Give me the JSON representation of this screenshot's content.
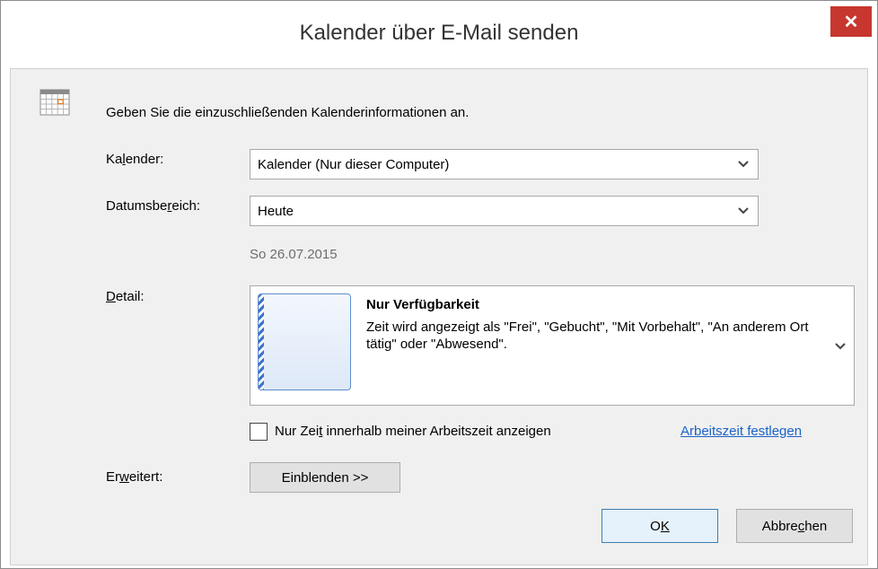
{
  "window": {
    "title": "Kalender über E-Mail senden",
    "close_glyph": "✕"
  },
  "header": {
    "instruction": "Geben Sie die einzuschließenden Kalenderinformationen an."
  },
  "calendar": {
    "label_a": "Ka",
    "label_u": "l",
    "label_b": "ender:",
    "value": "Kalender (Nur dieser Computer)"
  },
  "daterange": {
    "label_a": "Datumsbe",
    "label_u": "r",
    "label_b": "eich:",
    "value": "Heute",
    "date_note": "So 26.07.2015"
  },
  "detail": {
    "label_u": "D",
    "label_b": "etail:",
    "title": "Nur Verfügbarkeit",
    "description": "Zeit wird angezeigt als \"Frei\", \"Gebucht\", \"Mit Vorbehalt\", \"An anderem Ort tätig\" oder \"Abwesend\"."
  },
  "worktime": {
    "checkbox_a": "Nur Zei",
    "checkbox_u": "t",
    "checkbox_b": " innerhalb meiner Arbeitszeit anzeigen",
    "checked": false,
    "link": "Arbeitszeit festlegen"
  },
  "advanced": {
    "label_a": "Er",
    "label_u": "w",
    "label_b": "eitert:",
    "button": "Einblenden >>"
  },
  "footer": {
    "ok_a": "O",
    "ok_u": "K",
    "cancel_a": "Abbre",
    "cancel_u": "c",
    "cancel_b": "hen"
  },
  "icons": {
    "calendar": "calendar-icon",
    "chevron": "chevron-down-icon",
    "close": "close-icon"
  }
}
